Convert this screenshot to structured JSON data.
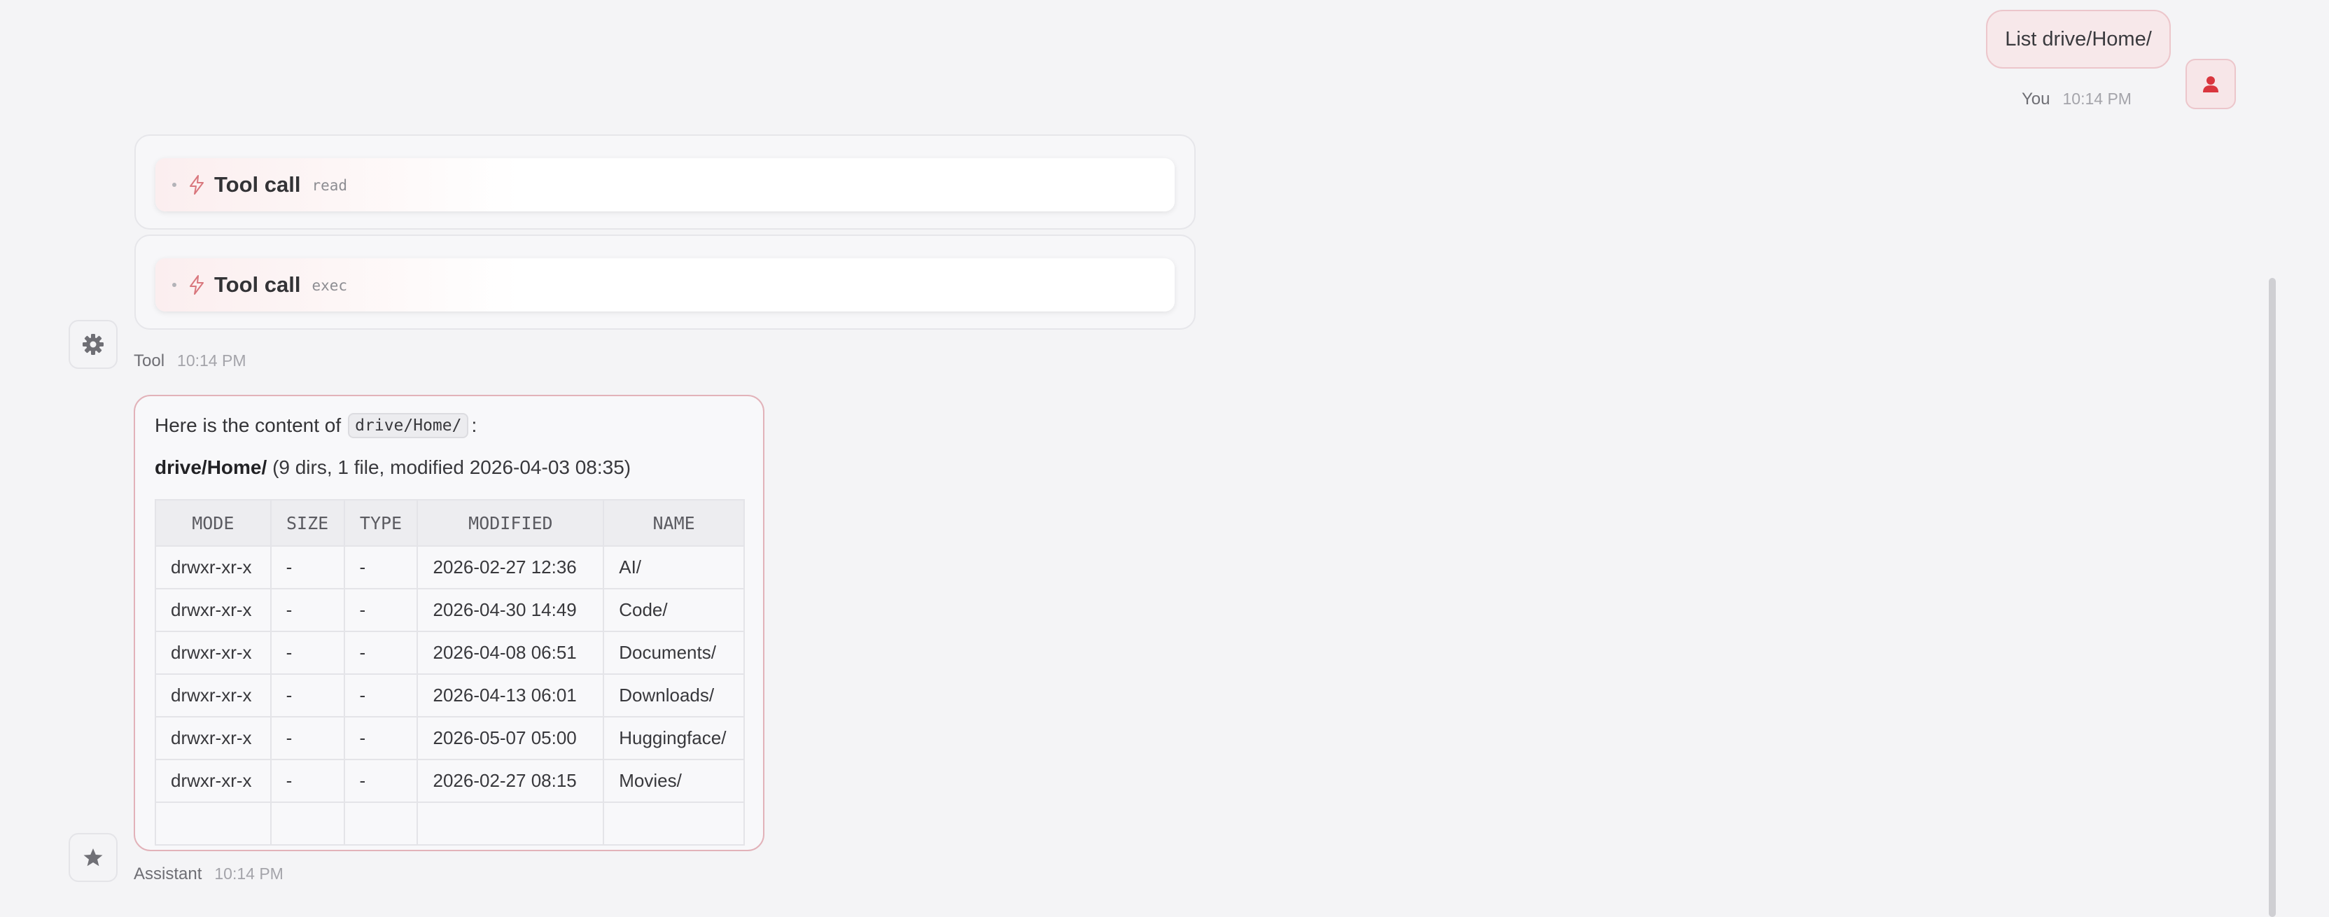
{
  "user_message": {
    "text": "List drive/Home/",
    "author": "You",
    "time": "10:14 PM",
    "avatar_icon": "user-icon"
  },
  "tool_message": {
    "calls": [
      {
        "label": "Tool call",
        "arg": "read",
        "icon": "bolt-icon"
      },
      {
        "label": "Tool call",
        "arg": "exec",
        "icon": "bolt-icon"
      }
    ],
    "author": "Tool",
    "time": "10:14 PM",
    "avatar_icon": "gear-icon"
  },
  "assistant_message": {
    "intro_text": "Here is the content of",
    "intro_code": "drive/Home/",
    "intro_suffix": ":",
    "summary_path": "drive/Home/",
    "summary_details": "(9 dirs, 1 file, modified 2026-04-03 08:35)",
    "table": {
      "headers": [
        "MODE",
        "SIZE",
        "TYPE",
        "MODIFIED",
        "NAME"
      ],
      "rows": [
        [
          "drwxr-xr-x",
          "-",
          "-",
          "2026-02-27 12:36",
          "AI/"
        ],
        [
          "drwxr-xr-x",
          "-",
          "-",
          "2026-04-30 14:49",
          "Code/"
        ],
        [
          "drwxr-xr-x",
          "-",
          "-",
          "2026-04-08 06:51",
          "Documents/"
        ],
        [
          "drwxr-xr-x",
          "-",
          "-",
          "2026-04-13 06:01",
          "Downloads/"
        ],
        [
          "drwxr-xr-x",
          "-",
          "-",
          "2026-05-07 05:00",
          "Huggingface/"
        ],
        [
          "drwxr-xr-x",
          "-",
          "-",
          "2026-02-27 08:15",
          "Movies/"
        ],
        [
          "",
          "",
          "",
          "",
          ""
        ]
      ]
    },
    "author": "Assistant",
    "time": "10:14 PM",
    "avatar_icon": "star-icon"
  },
  "colors": {
    "accent": "#d9363e",
    "bubble_border": "#e2b2b9",
    "background": "#f4f4f6"
  }
}
